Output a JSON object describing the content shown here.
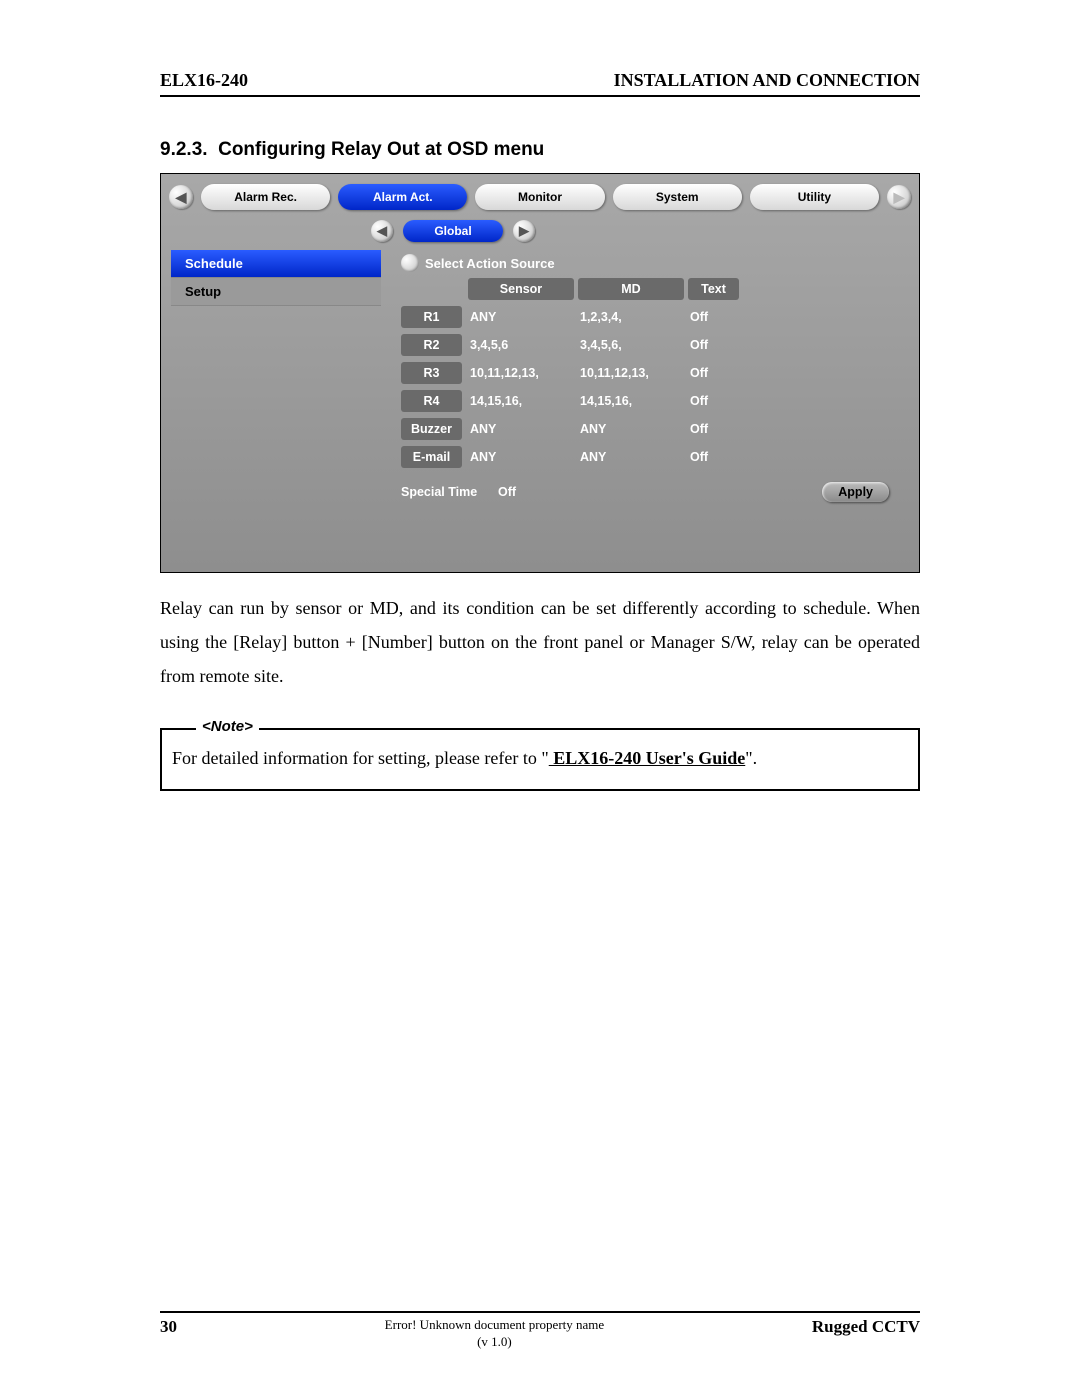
{
  "header": {
    "left": "ELX16-240",
    "right": "INSTALLATION AND CONNECTION"
  },
  "section": {
    "number": "9.2.3.",
    "title": "Configuring Relay Out at OSD menu"
  },
  "osd": {
    "tabs": [
      "Alarm Rec.",
      "Alarm Act.",
      "Monitor",
      "System",
      "Utility"
    ],
    "active_tab_index": 1,
    "subtab": "Global",
    "side": {
      "items": [
        "Schedule",
        "Setup"
      ],
      "selected_index": 0
    },
    "main": {
      "sas_label": "Select Action Source",
      "headers": [
        "",
        "Sensor",
        "MD",
        "Text"
      ],
      "rows": [
        {
          "label": "R1",
          "sensor": "ANY",
          "md": "1,2,3,4,",
          "text": "Off"
        },
        {
          "label": "R2",
          "sensor": "3,4,5,6",
          "md": "3,4,5,6,",
          "text": "Off"
        },
        {
          "label": "R3",
          "sensor": "10,11,12,13,",
          "md": "10,11,12,13,",
          "text": "Off"
        },
        {
          "label": "R4",
          "sensor": "14,15,16,",
          "md": "14,15,16,",
          "text": "Off"
        },
        {
          "label": "Buzzer",
          "sensor": "ANY",
          "md": "ANY",
          "text": "Off"
        },
        {
          "label": "E-mail",
          "sensor": "ANY",
          "md": "ANY",
          "text": "Off"
        }
      ],
      "special_time_label": "Special Time",
      "special_time_value": "Off",
      "apply_label": "Apply"
    }
  },
  "body_text": "Relay can run by sensor or MD, and its condition can be set differently according to schedule. When using the [Relay] button + [Number] button on the front panel or Manager S/W, relay can be operated from remote site.",
  "note": {
    "label": "<Note>",
    "pre": "For detailed information for setting, please refer to \"",
    "link": " ELX16-240  User's Guide",
    "post": "\"."
  },
  "footer": {
    "page": "30",
    "center1": "Error! Unknown document property name",
    "center2": "(v 1.0)",
    "right": "Rugged CCTV"
  }
}
